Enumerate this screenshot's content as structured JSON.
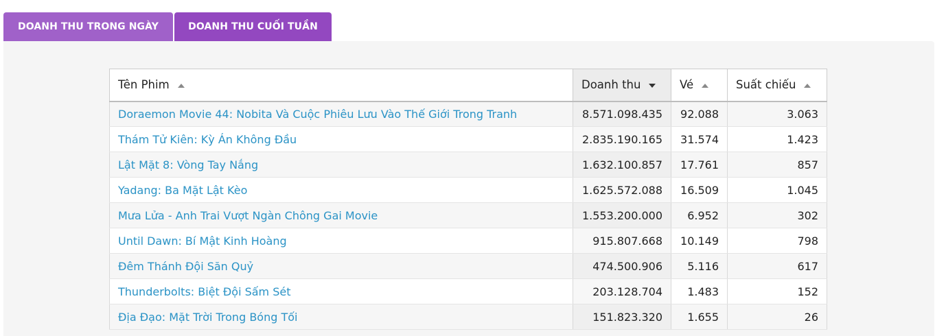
{
  "tabs": [
    {
      "label": "DOANH THU TRONG NGÀY",
      "active": true
    },
    {
      "label": "DOANH THU CUỐI TUẦN",
      "active": false
    }
  ],
  "table": {
    "headers": {
      "title": "Tên Phim",
      "revenue": "Doanh thu",
      "tickets": "Vé",
      "showings": "Suất chiếu"
    },
    "sorted_by": "revenue",
    "sort_direction": "desc",
    "rows": [
      {
        "title": "Doraemon Movie 44: Nobita Và Cuộc Phiêu Lưu Vào Thế Giới Trong Tranh",
        "revenue": "8.571.098.435",
        "tickets": "92.088",
        "showings": "3.063"
      },
      {
        "title": "Thám Tử Kiên: Kỳ Án Không Đầu",
        "revenue": "2.835.190.165",
        "tickets": "31.574",
        "showings": "1.423"
      },
      {
        "title": "Lật Mặt 8: Vòng Tay Nắng",
        "revenue": "1.632.100.857",
        "tickets": "17.761",
        "showings": "857"
      },
      {
        "title": "Yadang: Ba Mặt Lật Kèo",
        "revenue": "1.625.572.088",
        "tickets": "16.509",
        "showings": "1.045"
      },
      {
        "title": "Mưa Lửa - Anh Trai Vượt Ngàn Chông Gai Movie",
        "revenue": "1.553.200.000",
        "tickets": "6.952",
        "showings": "302"
      },
      {
        "title": "Until Dawn: Bí Mật Kinh Hoàng",
        "revenue": "915.807.668",
        "tickets": "10.149",
        "showings": "798"
      },
      {
        "title": "Đêm Thánh Đội Săn Quỷ",
        "revenue": "474.500.906",
        "tickets": "5.116",
        "showings": "617"
      },
      {
        "title": "Thunderbolts: Biệt Đội Sấm Sét",
        "revenue": "203.128.704",
        "tickets": "1.483",
        "showings": "152"
      },
      {
        "title": "Địa Đạo: Mặt Trời Trong Bóng Tối",
        "revenue": "151.823.320",
        "tickets": "1.655",
        "showings": "26"
      }
    ]
  },
  "colors": {
    "tab_active": "#a061c9",
    "tab_inactive": "#9348c0",
    "link": "#2b93c6",
    "panel_bg": "#f5f5f5"
  }
}
